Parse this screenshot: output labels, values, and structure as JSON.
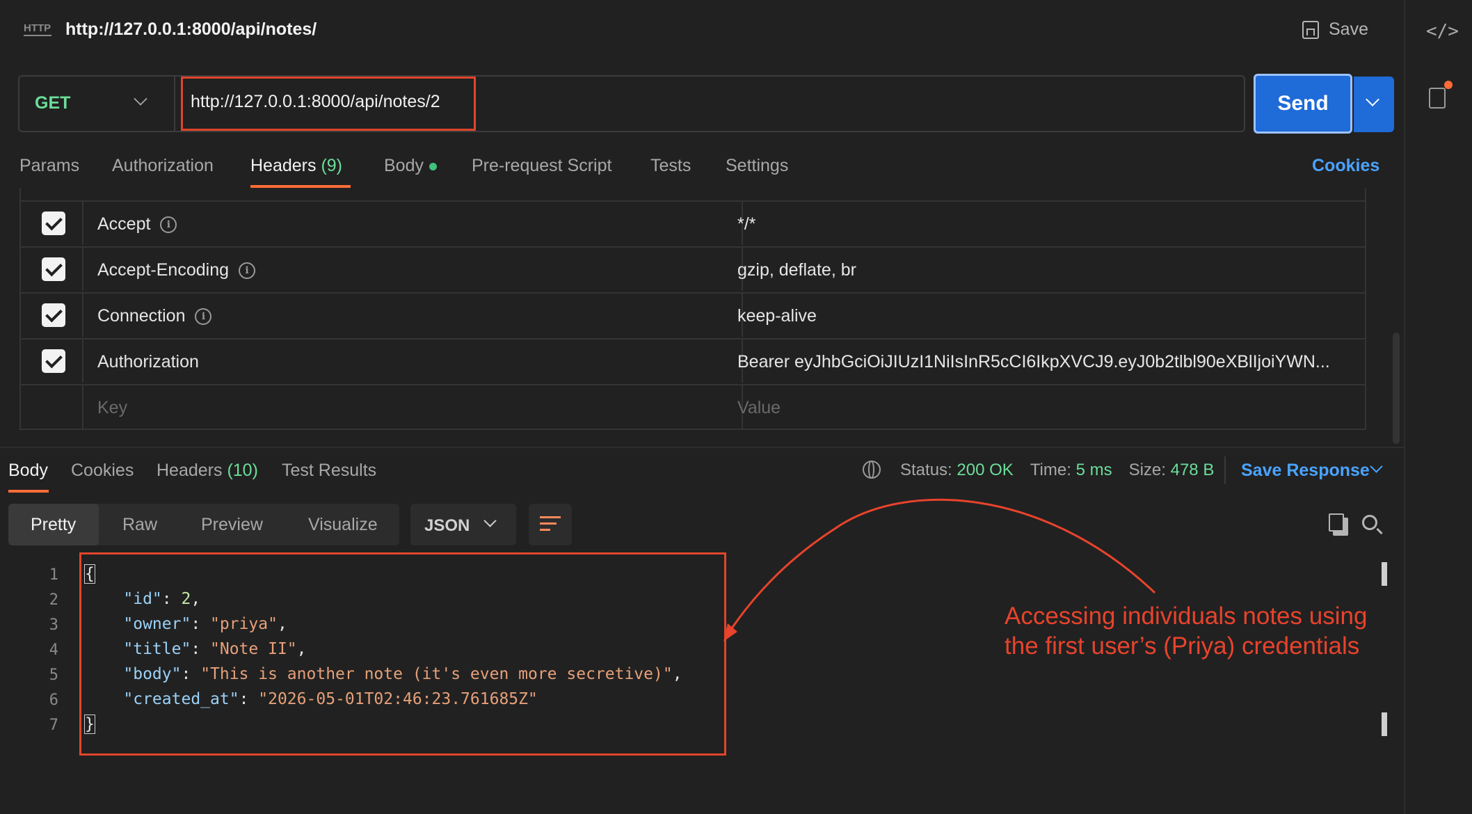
{
  "title_bar": {
    "icon": "http-icon",
    "icon_label": "HTTP",
    "request_name": "http://127.0.0.1:8000/api/notes/",
    "save_label": "Save"
  },
  "request": {
    "method": "GET",
    "url": "http://127.0.0.1:8000/api/notes/2",
    "send_label": "Send"
  },
  "request_tabs": {
    "params": "Params",
    "authorization": "Authorization",
    "headers": "Headers",
    "headers_count": "(9)",
    "body": "Body",
    "pre_request": "Pre-request Script",
    "tests": "Tests",
    "settings": "Settings",
    "cookies": "Cookies"
  },
  "headers_table": {
    "rows": [
      {
        "key": "Accept",
        "value": "*/*",
        "checked": true
      },
      {
        "key": "Accept-Encoding",
        "value": "gzip, deflate, br",
        "checked": true
      },
      {
        "key": "Connection",
        "value": "keep-alive",
        "checked": true
      },
      {
        "key": "Authorization",
        "value": "Bearer eyJhbGciOiJIUzI1NiIsInR5cCI6IkpXVCJ9.eyJ0b2tlbl90eXBlIjoiYWN...",
        "checked": true
      }
    ],
    "key_placeholder": "Key",
    "value_placeholder": "Value"
  },
  "response_tabs": {
    "body": "Body",
    "cookies": "Cookies",
    "headers": "Headers",
    "headers_count": "(10)",
    "test_results": "Test Results"
  },
  "response_status": {
    "status_label": "Status:",
    "status_value": "200 OK",
    "time_label": "Time:",
    "time_value": "5 ms",
    "size_label": "Size:",
    "size_value": "478 B",
    "save_response": "Save Response"
  },
  "view_modes": {
    "pretty": "Pretty",
    "raw": "Raw",
    "preview": "Preview",
    "visualize": "Visualize",
    "format": "JSON"
  },
  "response_body": {
    "line_numbers": [
      "1",
      "2",
      "3",
      "4",
      "5",
      "6",
      "7"
    ],
    "open_brace": "{",
    "close_brace": "}",
    "fields": [
      {
        "key": "\"id\"",
        "value": "2",
        "type": "number"
      },
      {
        "key": "\"owner\"",
        "value": "\"priya\"",
        "type": "string"
      },
      {
        "key": "\"title\"",
        "value": "\"Note II\"",
        "type": "string"
      },
      {
        "key": "\"body\"",
        "value": "\"This is another note (it's even more secretive)\"",
        "type": "string"
      },
      {
        "key": "\"created_at\"",
        "value": "\"2026-05-01T02:46:23.761685Z\"",
        "type": "string"
      }
    ]
  },
  "annotation": {
    "line1": "Accessing individuals notes using",
    "line2": "the first user’s (Priya)  credentials",
    "color": "#e8432c"
  },
  "colors": {
    "accent": "#ff6c37",
    "send_blue": "#1f6bd8",
    "success_green": "#6bdd9a",
    "link_blue": "#4aa3ff"
  }
}
